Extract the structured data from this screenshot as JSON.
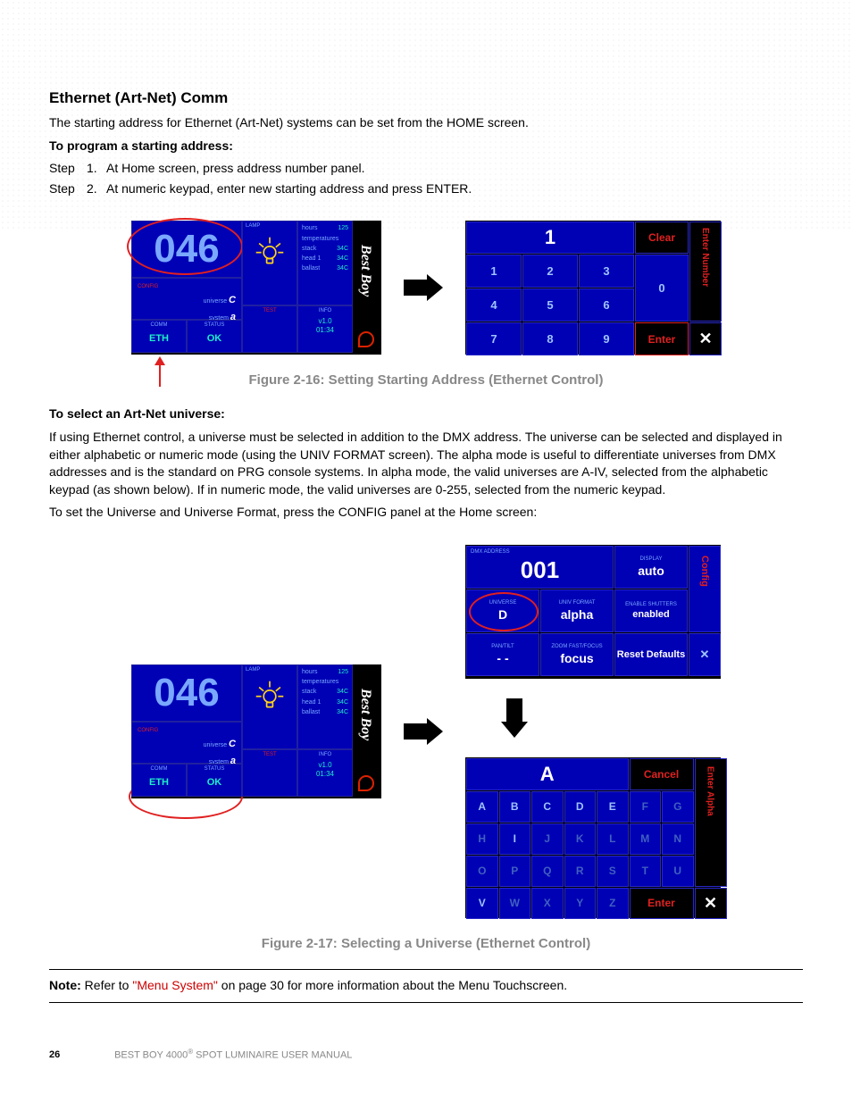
{
  "section": {
    "heading": "Ethernet (Art-Net) Comm",
    "intro": "The starting address for Ethernet (Art-Net) systems can be set from the HOME screen.",
    "procedure1_title": "To program a starting address:",
    "step1": "At Home screen, press address number panel.",
    "step2": "At numeric keypad, enter new starting address and press ENTER.",
    "step_label": "Step",
    "figure1_caption": "Figure 2-16:  Setting Starting Address (Ethernet Control)",
    "procedure2_title": "To select an Art-Net universe:",
    "para2": "If using Ethernet control, a universe must be selected in addition to the DMX address. The universe can be selected and displayed in either alphabetic or numeric mode (using the UNIV FORMAT screen). The alpha mode is useful to differentiate universes from DMX addresses and is the standard on PRG console systems. In alpha mode, the valid universes are A-IV, selected from the alphabetic keypad (as shown below). If in numeric mode, the valid universes are 0-255, selected from the numeric keypad.",
    "para3": "To set the Universe and Universe Format, press the CONFIG panel at the Home screen:",
    "figure2_caption": "Figure 2-17:  Selecting a Universe (Ethernet Control)"
  },
  "home": {
    "address": "046",
    "brand": "Best Boy",
    "config_label": "CONFIG",
    "universe_label": "universe",
    "universe_value": "C",
    "system_label": "system",
    "system_value": "a",
    "lamp_label": "LAMP",
    "temps_label": "temperatures",
    "hours_label": "hours",
    "hours_value": "125",
    "stack_label": "stack",
    "stack_value": "34C",
    "head_label": "head 1",
    "head_value": "34C",
    "ballast_label": "ballast",
    "ballast_value": "34C",
    "comm_label": "COMM",
    "comm_value": "ETH",
    "status_label": "STATUS",
    "status_value": "OK",
    "test_label": "TEST",
    "info_label": "INFO",
    "info_value1": "v1.0",
    "info_value2": "01:34"
  },
  "numpad": {
    "display": "1",
    "clear": "Clear",
    "zero": "0",
    "enter": "Enter",
    "close": "✕",
    "side_label": "Enter Number",
    "keys": [
      "1",
      "2",
      "3",
      "4",
      "5",
      "6",
      "7",
      "8",
      "9"
    ]
  },
  "config": {
    "dmx_label": "DMX ADDRESS",
    "dmx_value": "001",
    "display_label": "DISPLAY",
    "display_value": "auto",
    "universe_label": "UNIVERSE",
    "universe_value": "D",
    "univfmt_label": "UNIV FORMAT",
    "univfmt_value": "alpha",
    "shutters_label": "ENABLE SHUTTERS",
    "shutters_value": "enabled",
    "pantilt_label": "PAN/TILT",
    "pantilt_value": "- -",
    "zoom_label": "ZOOM FAST/FOCUS",
    "zoom_value": "focus",
    "reset_value": "Reset Defaults",
    "side_label": "Config",
    "close": "✕"
  },
  "alphapad": {
    "display": "A",
    "cancel": "Cancel",
    "enter": "Enter",
    "close": "✕",
    "side_label": "Enter Alpha",
    "row1": [
      "A",
      "B",
      "C",
      "D",
      "E",
      "F",
      "G"
    ],
    "row2": [
      "H",
      "I",
      "J",
      "K",
      "L",
      "M",
      "N"
    ],
    "row3": [
      "O",
      "P",
      "Q",
      "R",
      "S",
      "T",
      "U"
    ],
    "row4": [
      "V",
      "W",
      "X",
      "Y",
      "Z"
    ]
  },
  "note": {
    "label": "Note:",
    "pre": "Refer to ",
    "link": "\"Menu System\"",
    "post": " on page 30 for more information about the Menu Touchscreen."
  },
  "footer": {
    "page": "26",
    "manual_pre": "BEST BOY 4000",
    "manual_post": " SPOT LUMINAIRE USER MANUAL"
  }
}
